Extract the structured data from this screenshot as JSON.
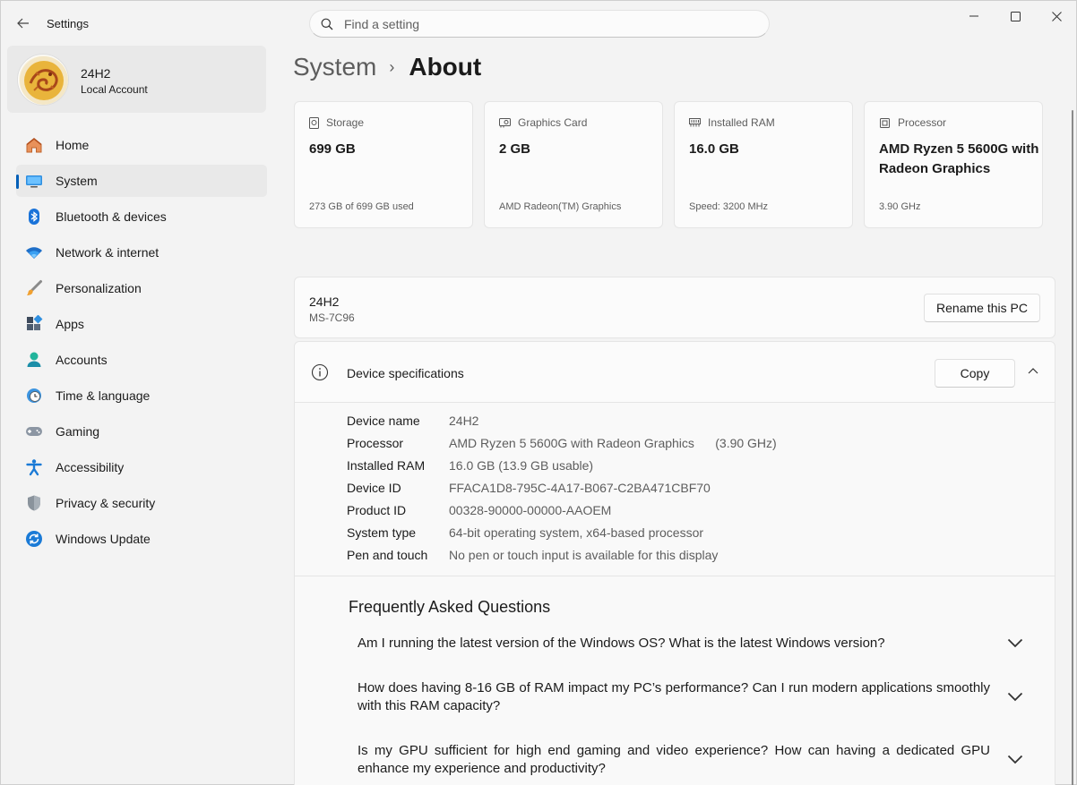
{
  "app": {
    "title": "Settings"
  },
  "search": {
    "placeholder": "Find a setting"
  },
  "profile": {
    "name": "24H2",
    "account_type": "Local Account"
  },
  "nav": {
    "items": [
      {
        "label": "Home",
        "icon": "home-icon"
      },
      {
        "label": "System",
        "icon": "system-icon",
        "active": true
      },
      {
        "label": "Bluetooth & devices",
        "icon": "bluetooth-icon"
      },
      {
        "label": "Network & internet",
        "icon": "wifi-icon"
      },
      {
        "label": "Personalization",
        "icon": "brush-icon"
      },
      {
        "label": "Apps",
        "icon": "apps-icon"
      },
      {
        "label": "Accounts",
        "icon": "person-icon"
      },
      {
        "label": "Time & language",
        "icon": "clock-globe-icon"
      },
      {
        "label": "Gaming",
        "icon": "gamepad-icon"
      },
      {
        "label": "Accessibility",
        "icon": "accessibility-icon"
      },
      {
        "label": "Privacy & security",
        "icon": "shield-icon"
      },
      {
        "label": "Windows Update",
        "icon": "update-icon"
      }
    ]
  },
  "breadcrumb": {
    "parent": "System",
    "separator": "›",
    "current": "About"
  },
  "cards": [
    {
      "label": "Storage",
      "icon": "storage-icon",
      "value": "699 GB",
      "sub": "273 GB of 699 GB used"
    },
    {
      "label": "Graphics Card",
      "icon": "gpu-icon",
      "value": "2 GB",
      "sub": "AMD Radeon(TM) Graphics"
    },
    {
      "label": "Installed RAM",
      "icon": "ram-icon",
      "value": "16.0 GB",
      "sub": "Speed: 3200 MHz"
    },
    {
      "label": "Processor",
      "icon": "cpu-icon",
      "value": "AMD Ryzen 5 5600G with Radeon Graphics",
      "sub": "3.90 GHz"
    }
  ],
  "pc": {
    "name": "24H2",
    "model": "MS-7C96",
    "rename_label": "Rename this PC"
  },
  "specs": {
    "title": "Device specifications",
    "copy_label": "Copy",
    "rows": [
      {
        "key": "Device name",
        "value": "24H2"
      },
      {
        "key": "Processor",
        "value": "AMD Ryzen 5 5600G with Radeon Graphics      (3.90 GHz)"
      },
      {
        "key": "Installed RAM",
        "value": "16.0 GB (13.9 GB usable)"
      },
      {
        "key": "Device ID",
        "value": "FFACA1D8-795C-4A17-B067-C2BA471CBF70"
      },
      {
        "key": "Product ID",
        "value": "00328-90000-00000-AAOEM"
      },
      {
        "key": "System type",
        "value": "64-bit operating system, x64-based processor"
      },
      {
        "key": "Pen and touch",
        "value": "No pen or touch input is available for this display"
      }
    ]
  },
  "faq": {
    "title": "Frequently Asked Questions",
    "items": [
      "Am I running the latest version of the Windows OS? What is the latest Windows version?",
      "How does having 8-16 GB of RAM impact my PC’s performance? Can I run modern applications smoothly with this RAM capacity?",
      "Is my GPU sufficient for high end gaming and video experience? How can having a dedicated GPU enhance my experience and productivity?"
    ]
  },
  "colors": {
    "accent": "#005fb8",
    "background": "#f3f3f3",
    "card": "#fbfbfb"
  }
}
